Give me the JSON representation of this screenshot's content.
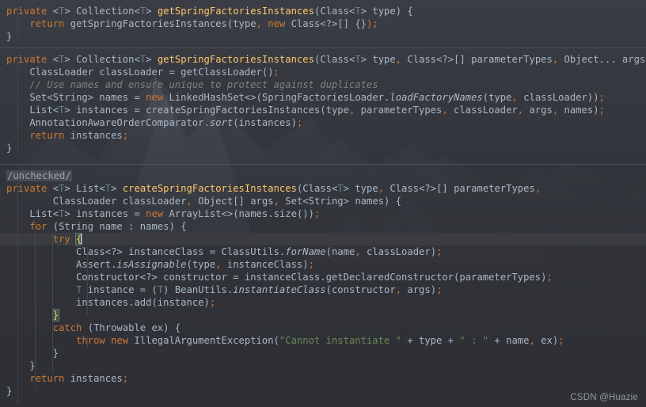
{
  "window": {
    "kind": "code-editor-screenshot",
    "theme": "darcula",
    "background_color": "#31333a",
    "default_text_color": "#a9b7c6"
  },
  "watermark": {
    "text": "CSDN @Huazie"
  },
  "colors": {
    "keyword": "#cc7832",
    "method_declaration": "#ffc66d",
    "string": "#6a8759",
    "comment": "#808080",
    "generic_type_param": "#5d8292",
    "default": "#a9b7c6",
    "annotation": "#bbb529",
    "brace_match_bg": "#3b514d",
    "current_line_bg": "#3a3c42",
    "separator": "#5a5d63",
    "chip_bg": "#474b52"
  },
  "code_blocks": [
    {
      "id": "block-1",
      "lines": [
        "private <T> Collection<T> getSpringFactoriesInstances(Class<T> type) {",
        "    return getSpringFactoriesInstances(type, new Class<?>[] {});",
        "}"
      ]
    },
    {
      "id": "block-2",
      "lines": [
        "private <T> Collection<T> getSpringFactoriesInstances(Class<T> type, Class<?>[] parameterTypes, Object... args) {",
        "    ClassLoader classLoader = getClassLoader();",
        "    // Use names and ensure unique to protect against duplicates",
        "    Set<String> names = new LinkedHashSet<>(SpringFactoriesLoader.loadFactoryNames(type, classLoader));",
        "    List<T> instances = createSpringFactoriesInstances(type, parameterTypes, classLoader, args, names);",
        "    AnnotationAwareOrderComparator.sort(instances);",
        "    return instances;",
        "}"
      ]
    },
    {
      "id": "block-3",
      "lines": [
        "/unchecked/",
        "private <T> List<T> createSpringFactoriesInstances(Class<T> type, Class<?>[] parameterTypes,",
        "        ClassLoader classLoader, Object[] args, Set<String> names) {",
        "    List<T> instances = new ArrayList<>(names.size());",
        "    for (String name : names) {",
        "        try {",
        "            Class<?> instanceClass = ClassUtils.forName(name, classLoader);",
        "            Assert.isAssignable(type, instanceClass);",
        "            Constructor<?> constructor = instanceClass.getDeclaredConstructor(parameterTypes);",
        "            T instance = (T) BeanUtils.instantiateClass(constructor, args);",
        "            instances.add(instance);",
        "        }",
        "        catch (Throwable ex) {",
        "            throw new IllegalArgumentException(\"Cannot instantiate \" + type + \" : \" + name, ex);",
        "        }",
        "    }",
        "    return instances;",
        "}"
      ]
    }
  ],
  "editor_state": {
    "caret_line_text": "        try {",
    "caret_after_token": "{",
    "matched_braces": [
      "{",
      "}"
    ],
    "current_line_highlighted": true,
    "suppression_chip": "/unchecked/"
  }
}
